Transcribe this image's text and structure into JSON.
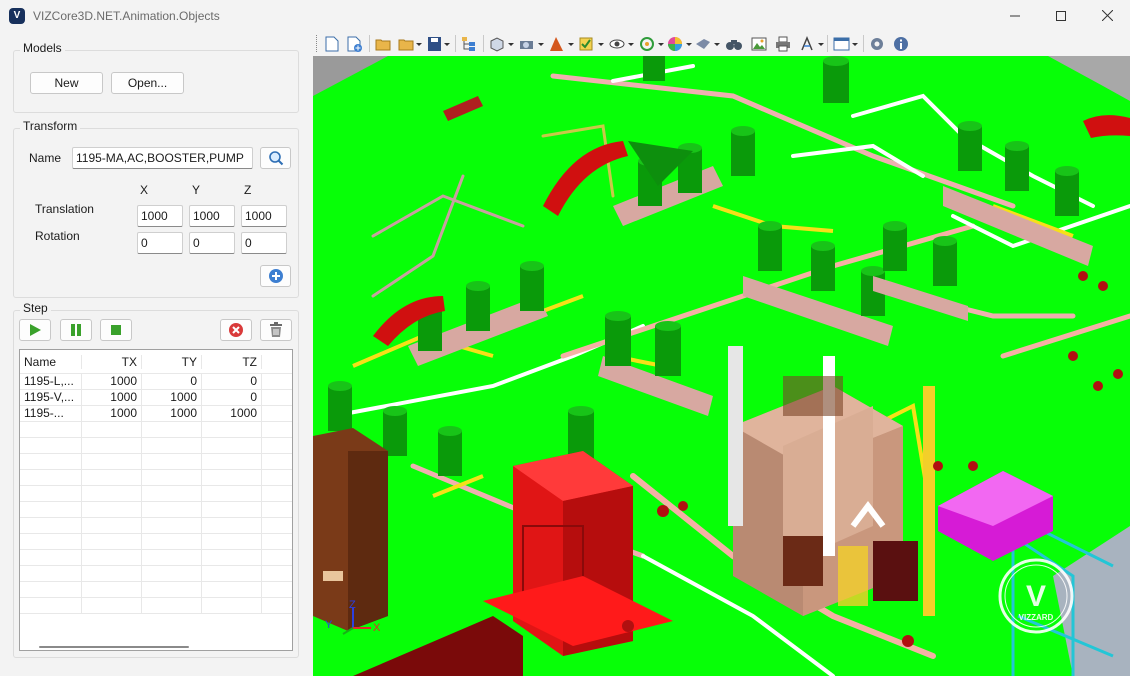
{
  "window": {
    "title": "VIZCore3D.NET.Animation.Objects",
    "app_icon_letter": "V",
    "controls": [
      "minimize-icon",
      "maximize-icon",
      "close-icon"
    ]
  },
  "models": {
    "group_label": "Models",
    "new_label": "New",
    "open_label": "Open..."
  },
  "transform": {
    "group_label": "Transform",
    "name_label": "Name",
    "name_value": "1195-MA,AC,BOOSTER,PUMP",
    "col_x": "X",
    "col_y": "Y",
    "col_z": "Z",
    "translation_label": "Translation",
    "rotation_label": "Rotation",
    "translation": {
      "x": "1000",
      "y": "1000",
      "z": "1000"
    },
    "rotation": {
      "x": "0",
      "y": "0",
      "z": "0"
    }
  },
  "step": {
    "group_label": "Step",
    "columns": [
      "Name",
      "TX",
      "TY",
      "TZ"
    ],
    "rows": [
      {
        "name": "1195-L,...",
        "tx": "1000",
        "ty": "0",
        "tz": "0"
      },
      {
        "name": "1195-V,...",
        "tx": "1000",
        "ty": "1000",
        "tz": "0"
      },
      {
        "name": "1195-...",
        "tx": "1000",
        "ty": "1000",
        "tz": "1000"
      }
    ]
  },
  "viewport": {
    "background_color": "#07ff07",
    "axis_labels": {
      "x": "X",
      "y": "Y",
      "z": "Z"
    },
    "logo_text": "VIZZARD",
    "logo_letter": "V"
  },
  "toolbar_icons": [
    "new-icon",
    "add-icon",
    "open-folder-icon",
    "open-recent-icon",
    "save-icon",
    "tree-icon",
    "view-icon",
    "camera-icon",
    "render-mode-icon",
    "select-icon",
    "visibility-icon",
    "rotate-icon",
    "color-icon",
    "zoom-icon",
    "find-icon",
    "screenshot-icon",
    "print-icon",
    "measure-icon",
    "window-icon",
    "settings-icon",
    "info-icon"
  ]
}
